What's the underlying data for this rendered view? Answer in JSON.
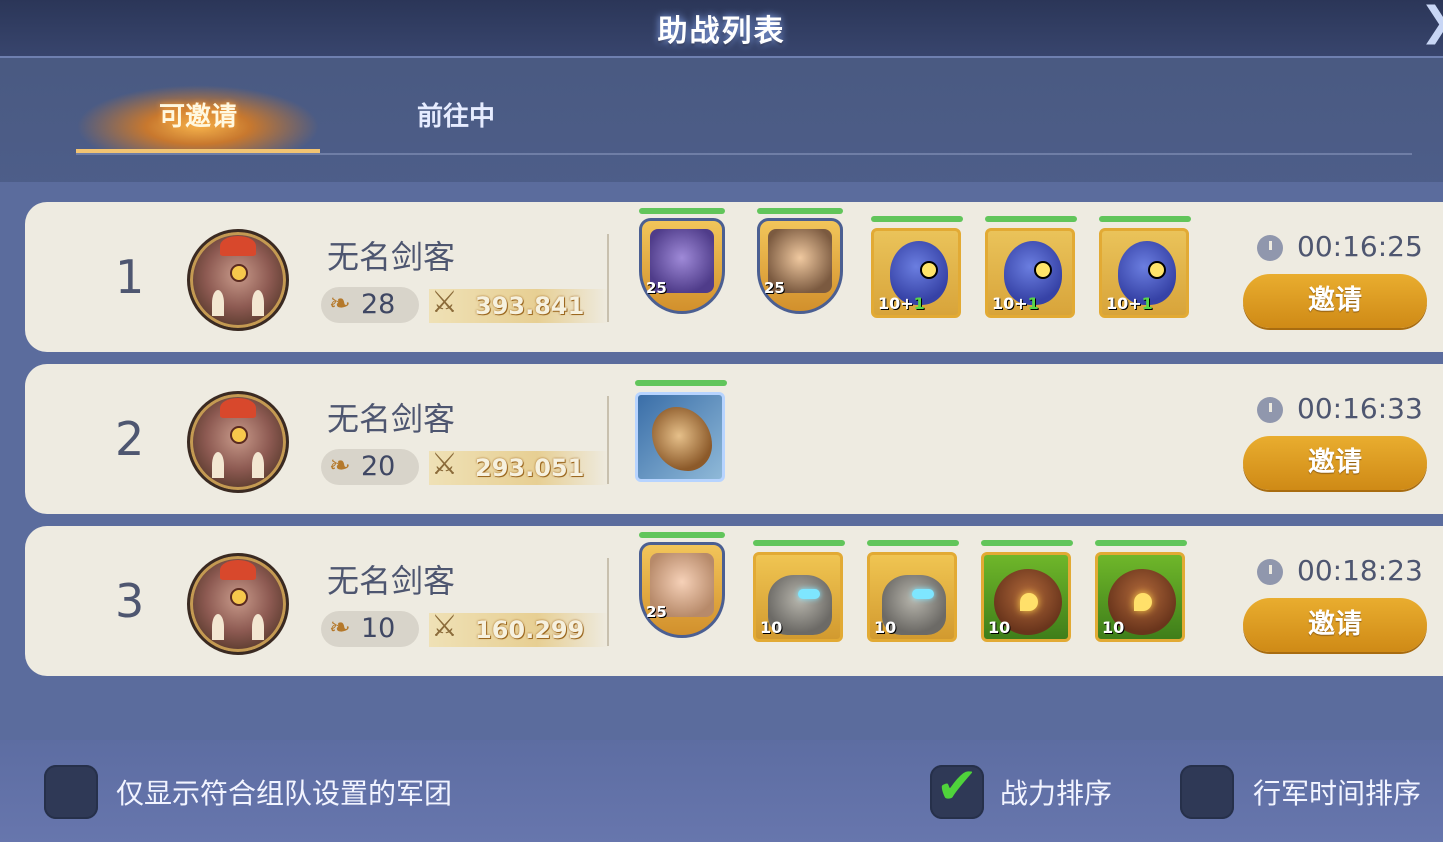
{
  "header": {
    "title": "助战列表",
    "close_icon": "chevron-right-icon"
  },
  "tabs": [
    {
      "label": "可邀请",
      "active": true
    },
    {
      "label": "前往中",
      "active": false
    }
  ],
  "rows": [
    {
      "rank": "1",
      "name": "无名剑客",
      "medal": "28",
      "power": "393.841",
      "timer": "00:16:25",
      "invite_label": "邀请",
      "units": [
        {
          "kind": "hero",
          "icon": "elf-hero-icon",
          "level": "25"
        },
        {
          "kind": "hero",
          "icon": "pilot-hero-icon",
          "level": "25"
        },
        {
          "kind": "troop",
          "icon": "blue-bird-icon",
          "level": "10+",
          "bonus": "1"
        },
        {
          "kind": "troop",
          "icon": "blue-bird-icon",
          "level": "10+",
          "bonus": "1"
        },
        {
          "kind": "troop",
          "icon": "blue-bird-icon",
          "level": "10+",
          "bonus": "1"
        }
      ]
    },
    {
      "rank": "2",
      "name": "无名剑客",
      "medal": "20",
      "power": "293.051",
      "timer": "00:16:33",
      "invite_label": "邀请",
      "units": [
        {
          "kind": "troop",
          "icon": "dragon-icon"
        }
      ]
    },
    {
      "rank": "3",
      "name": "无名剑客",
      "medal": "10",
      "power": "160.299",
      "timer": "00:18:23",
      "invite_label": "邀请",
      "units": [
        {
          "kind": "hero",
          "icon": "chubby-hero-icon",
          "level": "25"
        },
        {
          "kind": "troop",
          "icon": "rock-golem-icon",
          "level": "10"
        },
        {
          "kind": "troop",
          "icon": "rock-golem-icon",
          "level": "10"
        },
        {
          "kind": "troop",
          "icon": "nut-creature-icon",
          "level": "10"
        },
        {
          "kind": "troop",
          "icon": "nut-creature-icon",
          "level": "10"
        }
      ]
    }
  ],
  "footer": {
    "filter_label": "仅显示符合组队设置的军团",
    "filter_checked": false,
    "power_sort_label": "战力排序",
    "power_sort_checked": true,
    "time_sort_label": "行军时间排序",
    "time_sort_checked": false
  },
  "colors": {
    "accent": "#d99a22",
    "hp_bar": "#61c55b",
    "row_bg": "#eeebe1"
  }
}
